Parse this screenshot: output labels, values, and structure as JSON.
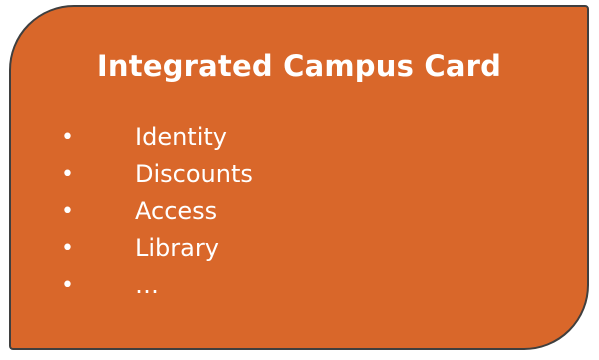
{
  "colors": {
    "card_background": "#d9672a",
    "card_border": "#3f3f3f",
    "text": "#ffffff"
  },
  "card": {
    "title": "Integrated Campus Card",
    "bullet_symbol": "•",
    "items": [
      {
        "label": "Identity"
      },
      {
        "label": "Discounts"
      },
      {
        "label": "Access"
      },
      {
        "label": "Library"
      },
      {
        "label": "…"
      }
    ]
  }
}
